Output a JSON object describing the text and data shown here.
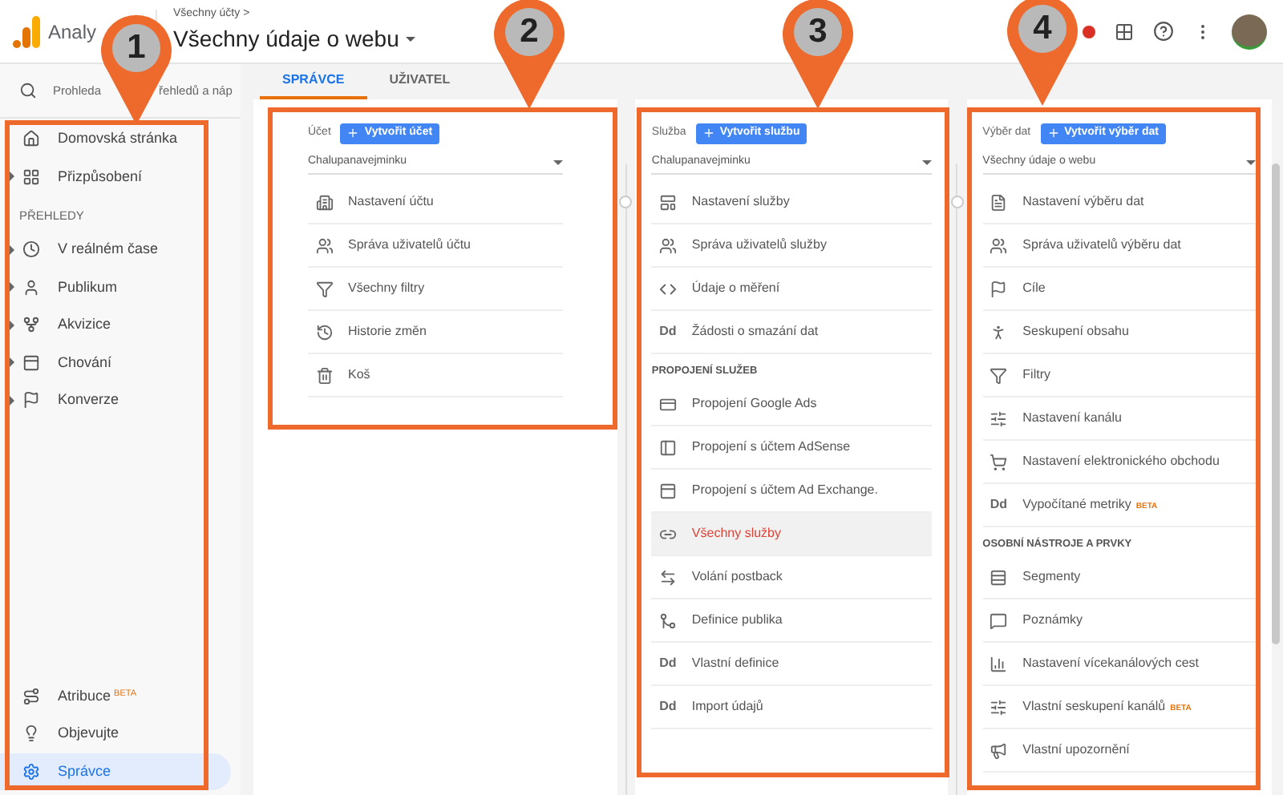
{
  "header": {
    "logo_text": "Analy",
    "breadcrumb": "Všechny účty >",
    "view_title": "Všechny údaje o webu"
  },
  "sidebar": {
    "search": {
      "text_start": "Prohleda",
      "text_end": "řehledů a náp"
    },
    "items": [
      {
        "kind": "link",
        "label": "Domovská stránka",
        "selected": false
      },
      {
        "kind": "group",
        "label": "Přizpůsobení",
        "selected": false
      },
      {
        "kind": "section",
        "label": "PŘEHLEDY"
      },
      {
        "kind": "group",
        "label": "V reálném čase",
        "selected": false
      },
      {
        "kind": "group",
        "label": "Publikum",
        "selected": false
      },
      {
        "kind": "group",
        "label": "Akvizice",
        "selected": false
      },
      {
        "kind": "group",
        "label": "Chování",
        "selected": false
      },
      {
        "kind": "group",
        "label": "Konverze",
        "selected": false
      }
    ],
    "bottom_items": [
      {
        "label": "Atribuce",
        "beta": "BETA",
        "selected": false
      },
      {
        "label": "Objevujte",
        "selected": false
      },
      {
        "label": "Správce",
        "selected": true
      }
    ]
  },
  "tabs": [
    {
      "label": "SPRÁVCE",
      "selected": true
    },
    {
      "label": "UŽIVATEL",
      "selected": false
    }
  ],
  "columns": [
    {
      "label": "Účet",
      "button": "Vytvořit účet",
      "select": "Chalupanavejminku",
      "items": [
        {
          "kind": "item",
          "label": "Nastavení účtu",
          "selected": false
        },
        {
          "kind": "item",
          "label": "Správa uživatelů účtu",
          "selected": false
        },
        {
          "kind": "item",
          "label": "Všechny filtry",
          "selected": false
        },
        {
          "kind": "item",
          "label": "Historie změn",
          "selected": false
        },
        {
          "kind": "item",
          "label": "Koš",
          "selected": false
        }
      ]
    },
    {
      "label": "Služba",
      "button": "Vytvořit službu",
      "select": "Chalupanavejminku",
      "items": [
        {
          "kind": "item",
          "label": "Nastavení služby",
          "selected": false
        },
        {
          "kind": "item",
          "label": "Správa uživatelů služby",
          "selected": false
        },
        {
          "kind": "item",
          "label": "Údaje o měření",
          "selected": false
        },
        {
          "kind": "item",
          "label": "Žádosti o smazání dat",
          "glyph": "Dd",
          "selected": false
        },
        {
          "kind": "section",
          "label": "PROPOJENÍ SLUŽEB"
        },
        {
          "kind": "item",
          "label": "Propojení Google Ads",
          "selected": false
        },
        {
          "kind": "item",
          "label": "Propojení s účtem AdSense",
          "selected": false
        },
        {
          "kind": "item",
          "label": "Propojení s účtem Ad Exchange.",
          "selected": false
        },
        {
          "kind": "item",
          "label": "Všechny služby",
          "selected": true
        },
        {
          "kind": "item",
          "label": "Volání postback",
          "selected": false
        },
        {
          "kind": "item",
          "label": "Definice publika",
          "selected": false
        },
        {
          "kind": "item",
          "label": "Vlastní definice",
          "glyph": "Dd",
          "selected": false
        },
        {
          "kind": "item",
          "label": "Import údajů",
          "glyph": "Dd",
          "selected": false
        }
      ]
    },
    {
      "label": "Výběr dat",
      "button": "Vytvořit výběr dat",
      "select": "Všechny údaje o webu",
      "items": [
        {
          "kind": "item",
          "label": "Nastavení výběru dat",
          "selected": false
        },
        {
          "kind": "item",
          "label": "Správa uživatelů výběru dat",
          "selected": false
        },
        {
          "kind": "item",
          "label": "Cíle",
          "selected": false
        },
        {
          "kind": "item",
          "label": "Seskupení obsahu",
          "selected": false
        },
        {
          "kind": "item",
          "label": "Filtry",
          "selected": false
        },
        {
          "kind": "item",
          "label": "Nastavení kanálu",
          "selected": false
        },
        {
          "kind": "item",
          "label": "Nastavení elektronického obchodu",
          "selected": false
        },
        {
          "kind": "item",
          "label": "Vypočítané metriky",
          "glyph": "Dd",
          "beta": "BETA",
          "selected": false
        },
        {
          "kind": "section",
          "label": "OSOBNÍ NÁSTROJE A PRVKY"
        },
        {
          "kind": "item",
          "label": "Segmenty",
          "selected": false
        },
        {
          "kind": "item",
          "label": "Poznámky",
          "selected": false
        },
        {
          "kind": "item",
          "label": "Nastavení vícekanálových cest",
          "selected": false
        },
        {
          "kind": "item",
          "label": "Vlastní seskupení kanálů",
          "beta": "BETA",
          "selected": false
        },
        {
          "kind": "item",
          "label": "Vlastní upozornění",
          "selected": false
        }
      ]
    }
  ],
  "annotations": [
    {
      "number": "1"
    },
    {
      "number": "2"
    },
    {
      "number": "3"
    },
    {
      "number": "4"
    }
  ]
}
